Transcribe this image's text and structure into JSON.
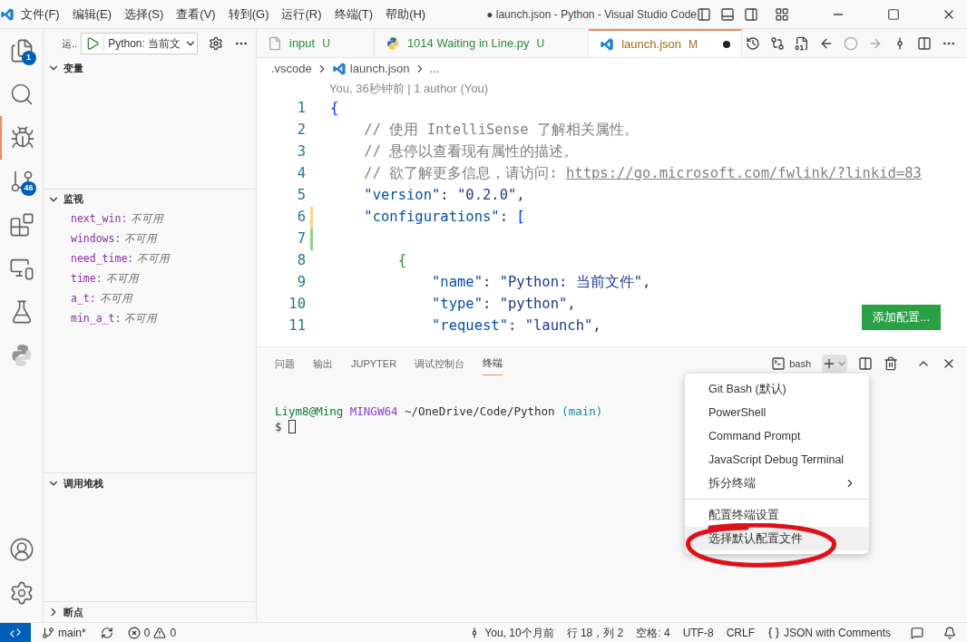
{
  "title_bar": {
    "menus": [
      "文件(F)",
      "编辑(E)",
      "选择(S)",
      "查看(V)",
      "转到(G)",
      "运行(R)",
      "终端(T)",
      "帮助(H)"
    ],
    "title": "● launch.json - Python - Visual Studio Code"
  },
  "activity_bar": [
    {
      "kind": "files",
      "badge": "1",
      "selected": false
    },
    {
      "kind": "search",
      "selected": false
    },
    {
      "kind": "debug",
      "selected": true
    },
    {
      "kind": "git",
      "badge": "46",
      "selected": false
    },
    {
      "kind": "extensions",
      "selected": false
    },
    {
      "kind": "remote",
      "selected": false
    },
    {
      "kind": "flask",
      "selected": false
    },
    {
      "kind": "python",
      "selected": false
    }
  ],
  "activity_bottom": [
    {
      "kind": "account"
    },
    {
      "kind": "settings"
    }
  ],
  "side_bar": {
    "title": "运..",
    "launch_config": "Python: 当前文",
    "sections": [
      {
        "title": "变量",
        "expanded": true,
        "kind": "empty"
      },
      {
        "title": "监视",
        "expanded": true,
        "kind": "watch",
        "items": [
          {
            "name": "next_win:",
            "value": "不可用"
          },
          {
            "name": "windows:",
            "value": "不可用"
          },
          {
            "name": "need_time:",
            "value": "不可用"
          },
          {
            "name": "time:",
            "value": "不可用"
          },
          {
            "name": "a_t:",
            "value": "不可用"
          },
          {
            "name": "min_a_t:",
            "value": "不可用"
          }
        ]
      },
      {
        "title": "调用堆栈",
        "expanded": true,
        "kind": "empty"
      },
      {
        "title": "断点",
        "expanded": false,
        "kind": "empty"
      }
    ]
  },
  "editor_tabs": [
    {
      "label": "input",
      "kind": "file",
      "status": "U",
      "color": "#2f8a3d",
      "selected": false,
      "dirty": false
    },
    {
      "label": "1014 Waiting in Line.py",
      "kind": "python",
      "status": "U",
      "color": "#2f8a3d",
      "selected": false,
      "dirty": false
    },
    {
      "label": "launch.json",
      "kind": "vscode",
      "status": "M",
      "color": "#a06b1c",
      "selected": true,
      "dirty": true
    }
  ],
  "breadcrumb": [
    ".vscode",
    "launch.json",
    "..."
  ],
  "blame": "You, 36秒钟前 | 1 author (You)",
  "code_lines": [
    {
      "number": "1",
      "segments": [
        {
          "kind": "bracket",
          "text": "{",
          "color": "#0431fa"
        }
      ]
    },
    {
      "number": "2",
      "segments": [
        {
          "kind": "comment",
          "text": "    // 使用 IntelliSense 了解相关属性。"
        }
      ]
    },
    {
      "number": "3",
      "segments": [
        {
          "kind": "comment",
          "text": "    // 悬停以查看现有属性的描述。"
        }
      ]
    },
    {
      "number": "4",
      "segments": [
        {
          "kind": "comment",
          "text": "    // 欲了解更多信息，请访问: "
        },
        {
          "kind": "link",
          "text": "https://go.microsoft.com/fwlink/?linkid=83"
        }
      ]
    },
    {
      "number": "5",
      "segments": [
        {
          "kind": "key",
          "text": "    \"version\""
        },
        {
          "kind": "plain",
          "text": ": "
        },
        {
          "kind": "string",
          "text": "\"0.2.0\""
        },
        {
          "kind": "plain",
          "text": ","
        }
      ]
    },
    {
      "number": "6",
      "kind": "modified",
      "segments": [
        {
          "kind": "key",
          "text": "    \"configurations\""
        },
        {
          "kind": "plain",
          "text": ": "
        },
        {
          "kind": "bracket",
          "text": "[",
          "color": "#0431fa"
        }
      ]
    },
    {
      "number": "7",
      "kind": "added"
    },
    {
      "number": "8",
      "segments": [
        {
          "kind": "bracket",
          "text": "        {",
          "color": "#319331"
        }
      ]
    },
    {
      "number": "9",
      "segments": [
        {
          "kind": "key",
          "text": "            \"name\""
        },
        {
          "kind": "plain",
          "text": ": "
        },
        {
          "kind": "string",
          "text": "\"Python: 当前文件\""
        },
        {
          "kind": "plain",
          "text": ","
        }
      ]
    },
    {
      "number": "10",
      "segments": [
        {
          "kind": "key",
          "text": "            \"type\""
        },
        {
          "kind": "plain",
          "text": ": "
        },
        {
          "kind": "string",
          "text": "\"python\""
        },
        {
          "kind": "plain",
          "text": ","
        }
      ]
    },
    {
      "number": "11",
      "segments": [
        {
          "kind": "key",
          "text": "            \"request\""
        },
        {
          "kind": "plain",
          "text": ": "
        },
        {
          "kind": "string",
          "text": "\"launch\""
        },
        {
          "kind": "plain",
          "text": ","
        }
      ]
    }
  ],
  "add_config_button": "添加配置...",
  "panel": {
    "tabs": [
      {
        "label": "问题",
        "selected": false
      },
      {
        "label": "输出",
        "selected": false
      },
      {
        "label": "JUPYTER",
        "selected": false
      },
      {
        "label": "调试控制台",
        "selected": false
      },
      {
        "label": "终端",
        "selected": true
      }
    ],
    "terminal_name": "bash",
    "terminal_lines": [
      [
        {
          "kind": "user",
          "text": "Liym8@Ming"
        },
        {
          "kind": "host",
          "text": " MINGW64"
        },
        {
          "kind": "plain",
          "text": " ~/OneDrive/Code/Python "
        },
        {
          "kind": "branch",
          "text": "(main)"
        }
      ],
      [
        {
          "kind": "plain",
          "text": "$ "
        },
        {
          "kind": "cursor"
        }
      ]
    ],
    "menu": {
      "groups": [
        [
          {
            "label": "Git Bash (默认)",
            "submenu": false,
            "selected": false
          },
          {
            "label": "PowerShell",
            "submenu": false,
            "selected": false
          },
          {
            "label": "Command Prompt",
            "submenu": false,
            "selected": false
          },
          {
            "label": "JavaScript Debug Terminal",
            "submenu": false,
            "selected": false
          },
          {
            "label": "拆分终端",
            "submenu": true,
            "selected": false
          }
        ],
        [
          {
            "label": "配置终端设置",
            "submenu": false,
            "selected": false
          },
          {
            "label": "选择默认配置文件",
            "submenu": false,
            "selected": true
          }
        ]
      ]
    }
  },
  "status_bar": {
    "branch": "main*",
    "errors": "0",
    "warnings": "0",
    "right": [
      {
        "kind": "blame",
        "text": "You, 10个月前"
      },
      {
        "kind": "text",
        "text": "行 18，列 2"
      },
      {
        "kind": "text",
        "text": "空格: 4"
      },
      {
        "kind": "text",
        "text": "UTF-8"
      },
      {
        "kind": "text",
        "text": "CRLF"
      },
      {
        "kind": "language",
        "text": "JSON with Comments"
      }
    ]
  }
}
